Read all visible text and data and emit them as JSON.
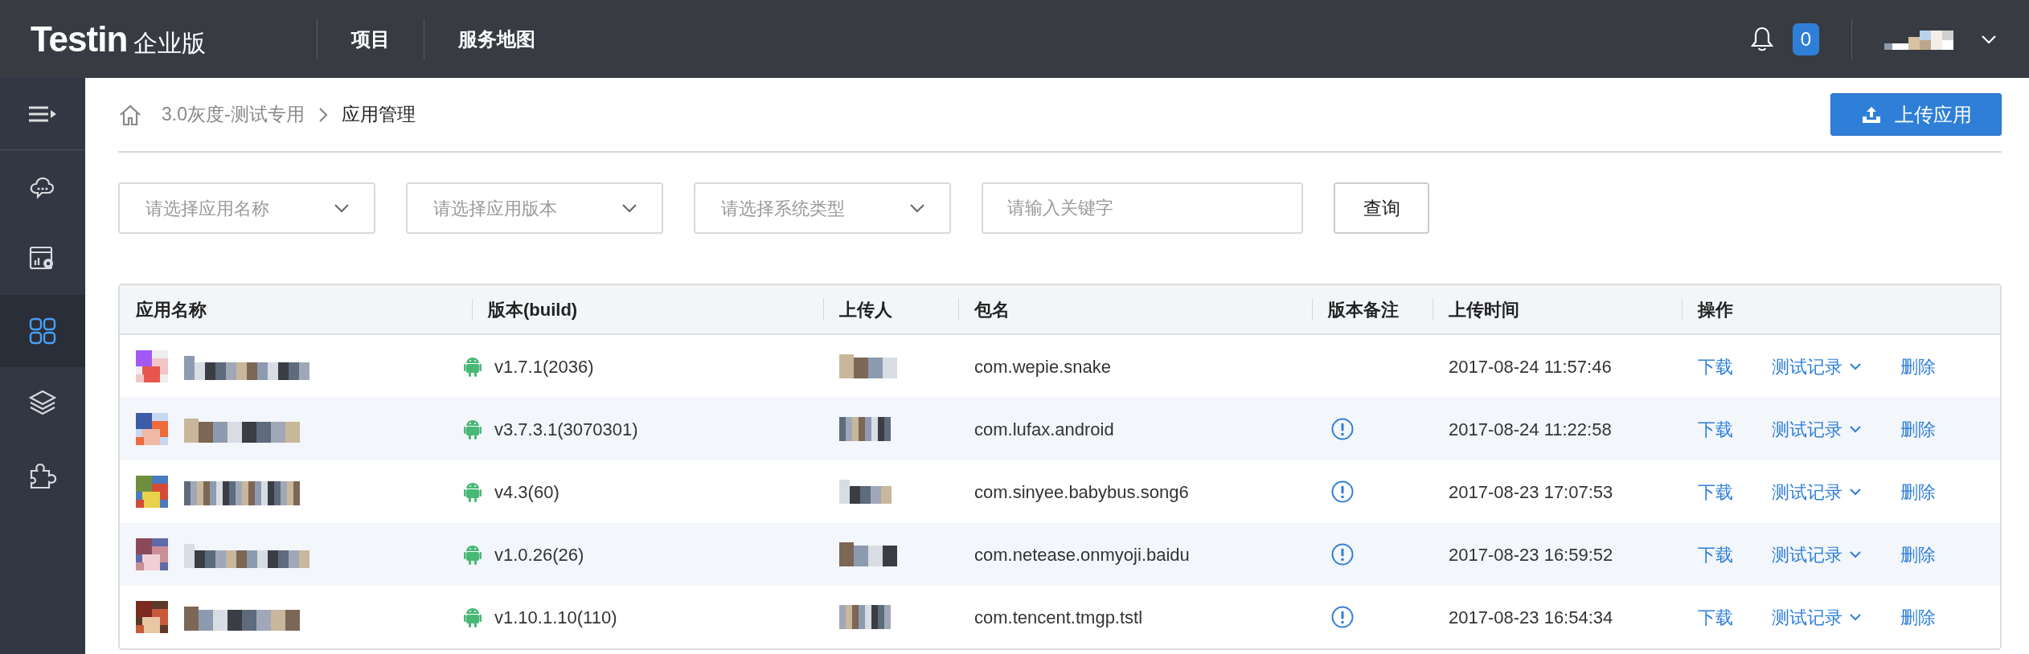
{
  "topbar": {
    "logo": "Testin",
    "edition": "企业版",
    "nav": [
      {
        "label": "项目"
      },
      {
        "label": "服务地图"
      }
    ],
    "notification_count": "0"
  },
  "sidebar": {
    "items": [
      {
        "kind": "cloud",
        "selected": false
      },
      {
        "kind": "dashboard",
        "selected": false
      },
      {
        "kind": "apps",
        "selected": true
      },
      {
        "kind": "layers",
        "selected": false
      },
      {
        "kind": "plugin",
        "selected": false
      }
    ]
  },
  "breadcrumb": [
    "3.0灰度-测试专用",
    "应用管理"
  ],
  "upload_button": "上传应用",
  "filters": [
    {
      "kind": "select",
      "placeholder": "请选择应用名称"
    },
    {
      "kind": "select",
      "placeholder": "请选择应用版本"
    },
    {
      "kind": "select",
      "placeholder": "请选择系统类型"
    },
    {
      "kind": "input",
      "placeholder": "请输入关键字"
    }
  ],
  "query_button": "查询",
  "table": {
    "columns": [
      "应用名称",
      "版本(build)",
      "上传人",
      "包名",
      "版本备注",
      "上传时间",
      "操作"
    ],
    "rows": [
      {
        "version": "v1.7.1(2036)",
        "package": "com.wepie.snake",
        "has_note": false,
        "time": "2017-08-24 11:57:46",
        "actions": [
          "下载",
          "测试记录",
          "删除"
        ]
      },
      {
        "version": "v3.7.3.1(3070301)",
        "package": "com.lufax.android",
        "has_note": true,
        "time": "2017-08-24 11:22:58",
        "actions": [
          "下载",
          "测试记录",
          "删除"
        ]
      },
      {
        "version": "v4.3(60)",
        "package": "com.sinyee.babybus.song6",
        "has_note": true,
        "time": "2017-08-23 17:07:53",
        "actions": [
          "下载",
          "测试记录",
          "删除"
        ]
      },
      {
        "version": "v1.0.26(26)",
        "package": "com.netease.onmyoji.baidu",
        "has_note": true,
        "time": "2017-08-23 16:59:52",
        "actions": [
          "下载",
          "测试记录",
          "删除"
        ]
      },
      {
        "version": "v1.10.1.10(110)",
        "package": "com.tencent.tmgp.tstl",
        "has_note": true,
        "time": "2017-08-23 16:54:34",
        "actions": [
          "下载",
          "测试记录",
          "删除"
        ]
      }
    ]
  }
}
